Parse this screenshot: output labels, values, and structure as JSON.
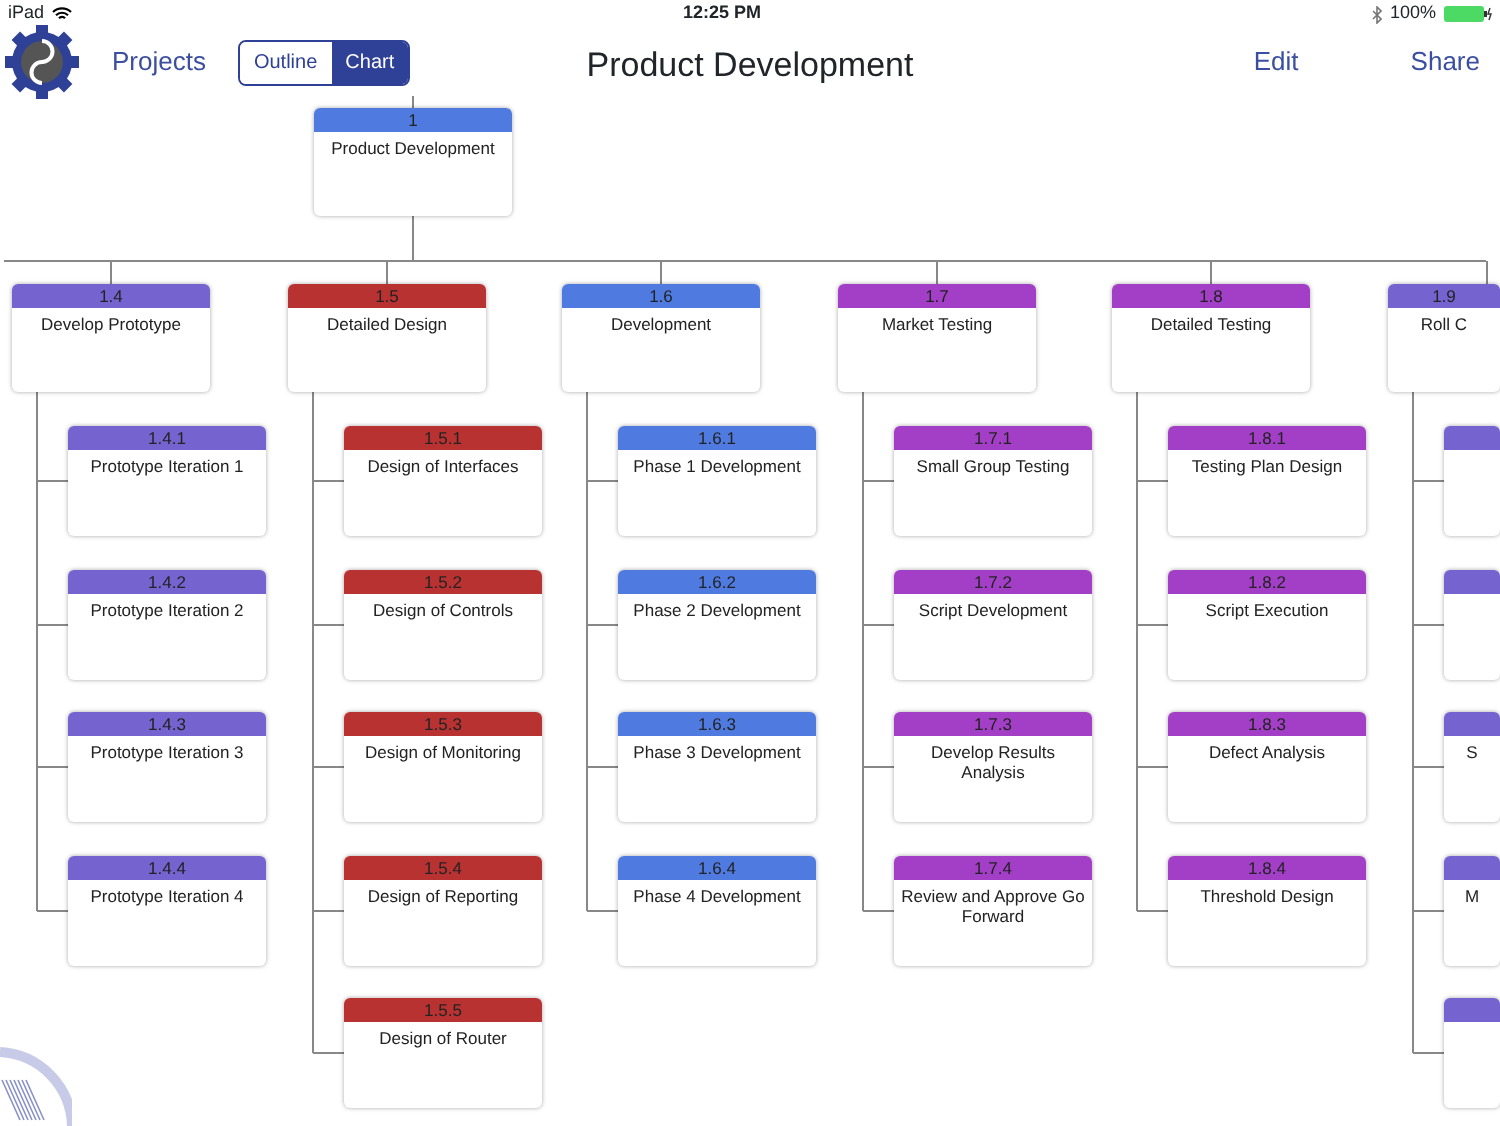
{
  "status_bar": {
    "device": "iPad",
    "time": "12:25 PM",
    "battery": "100%"
  },
  "nav": {
    "back": "Projects",
    "segments": [
      {
        "label": "Outline",
        "selected": false
      },
      {
        "label": "Chart",
        "selected": true
      }
    ],
    "title": "Product Development",
    "actions": [
      "Edit",
      "Share"
    ]
  },
  "chart": {
    "root": {
      "number": "1",
      "label": "Product Development",
      "color": "#4f7be0",
      "children": [
        {
          "number": "1.4",
          "label": "Develop Prototype",
          "color": "#7563d0",
          "children": [
            {
              "number": "1.4.1",
              "label": "Prototype Iteration 1",
              "color": "#7563d0"
            },
            {
              "number": "1.4.2",
              "label": "Prototype Iteration 2",
              "color": "#7563d0"
            },
            {
              "number": "1.4.3",
              "label": "Prototype Iteration 3",
              "color": "#7563d0"
            },
            {
              "number": "1.4.4",
              "label": "Prototype Iteration 4",
              "color": "#7563d0"
            }
          ]
        },
        {
          "number": "1.5",
          "label": "Detailed Design",
          "color": "#b83232",
          "children": [
            {
              "number": "1.5.1",
              "label": "Design of Interfaces",
              "color": "#b83232"
            },
            {
              "number": "1.5.2",
              "label": "Design of Controls",
              "color": "#b83232"
            },
            {
              "number": "1.5.3",
              "label": "Design of Monitoring",
              "color": "#b83232"
            },
            {
              "number": "1.5.4",
              "label": "Design of Reporting",
              "color": "#b83232"
            },
            {
              "number": "1.5.5",
              "label": "Design of Router",
              "color": "#b83232"
            }
          ]
        },
        {
          "number": "1.6",
          "label": "Development",
          "color": "#4f7be0",
          "children": [
            {
              "number": "1.6.1",
              "label": "Phase 1 Development",
              "color": "#4f7be0"
            },
            {
              "number": "1.6.2",
              "label": "Phase 2 Development",
              "color": "#4f7be0"
            },
            {
              "number": "1.6.3",
              "label": "Phase 3 Development",
              "color": "#4f7be0"
            },
            {
              "number": "1.6.4",
              "label": "Phase 4 Development",
              "color": "#4f7be0"
            }
          ]
        },
        {
          "number": "1.7",
          "label": "Market Testing",
          "color": "#a23fc6",
          "children": [
            {
              "number": "1.7.1",
              "label": "Small Group Testing",
              "color": "#a23fc6"
            },
            {
              "number": "1.7.2",
              "label": "Script Development",
              "color": "#a23fc6"
            },
            {
              "number": "1.7.3",
              "label": "Develop Results Analysis",
              "color": "#a23fc6"
            },
            {
              "number": "1.7.4",
              "label": "Review and Approve Go Forward",
              "color": "#a23fc6"
            }
          ]
        },
        {
          "number": "1.8",
          "label": "Detailed Testing",
          "color": "#a23fc6",
          "children": [
            {
              "number": "1.8.1",
              "label": "Testing Plan Design",
              "color": "#a23fc6"
            },
            {
              "number": "1.8.2",
              "label": "Script Execution",
              "color": "#a23fc6"
            },
            {
              "number": "1.8.3",
              "label": "Defect Analysis",
              "color": "#a23fc6"
            },
            {
              "number": "1.8.4",
              "label": "Threshold Design",
              "color": "#a23fc6"
            }
          ]
        },
        {
          "number": "1.9",
          "label": "Roll C",
          "color": "#7563d0",
          "children": [
            {
              "color": "#7563d0"
            },
            {
              "color": "#7563d0"
            },
            {
              "label": "S",
              "color": "#7563d0"
            },
            {
              "label": "M",
              "color": "#7563d0"
            },
            {
              "color": "#7563d0"
            }
          ]
        }
      ]
    }
  }
}
